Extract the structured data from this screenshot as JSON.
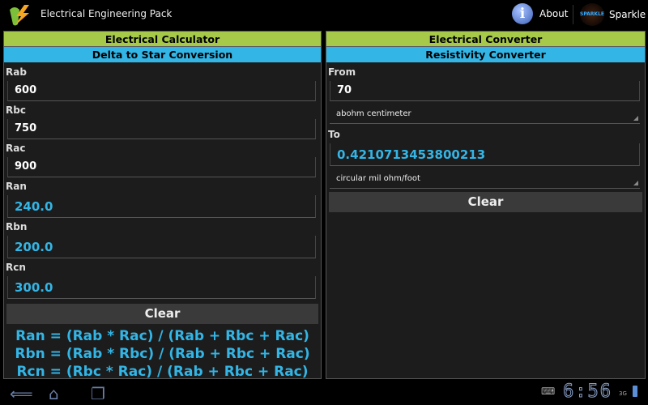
{
  "app": {
    "title": "Electrical Engineering Pack",
    "about": "About",
    "sparkle": "Sparkle",
    "sparkle_logo_text": "SPARKLE"
  },
  "left": {
    "header": "Electrical Calculator",
    "subheader": "Delta to Star Conversion",
    "inputs": [
      {
        "label": "Rab",
        "value": "600"
      },
      {
        "label": "Rbc",
        "value": "750"
      },
      {
        "label": "Rac",
        "value": "900"
      }
    ],
    "outputs": [
      {
        "label": "Ran",
        "value": "240.0"
      },
      {
        "label": "Rbn",
        "value": "200.0"
      },
      {
        "label": "Rcn",
        "value": "300.0"
      }
    ],
    "clear": "Clear",
    "formulas": [
      "Ran = (Rab * Rac) / (Rab + Rbc + Rac)",
      "Rbn = (Rab * Rbc) / (Rab + Rbc + Rac)",
      "Rcn = (Rbc * Rac) / (Rab + Rbc + Rac)"
    ]
  },
  "right": {
    "header": "Electrical Converter",
    "subheader": "Resistivity Converter",
    "from_label": "From",
    "from_value": "70",
    "from_unit": "abohm centimeter",
    "to_label": "To",
    "to_value": "0.4210713453800213",
    "to_unit": "circular mil ohm/foot",
    "clear": "Clear"
  },
  "status": {
    "time": "6:56",
    "network": "3G"
  },
  "colors": {
    "green": "#a7c94a",
    "blue": "#33b5e5"
  }
}
